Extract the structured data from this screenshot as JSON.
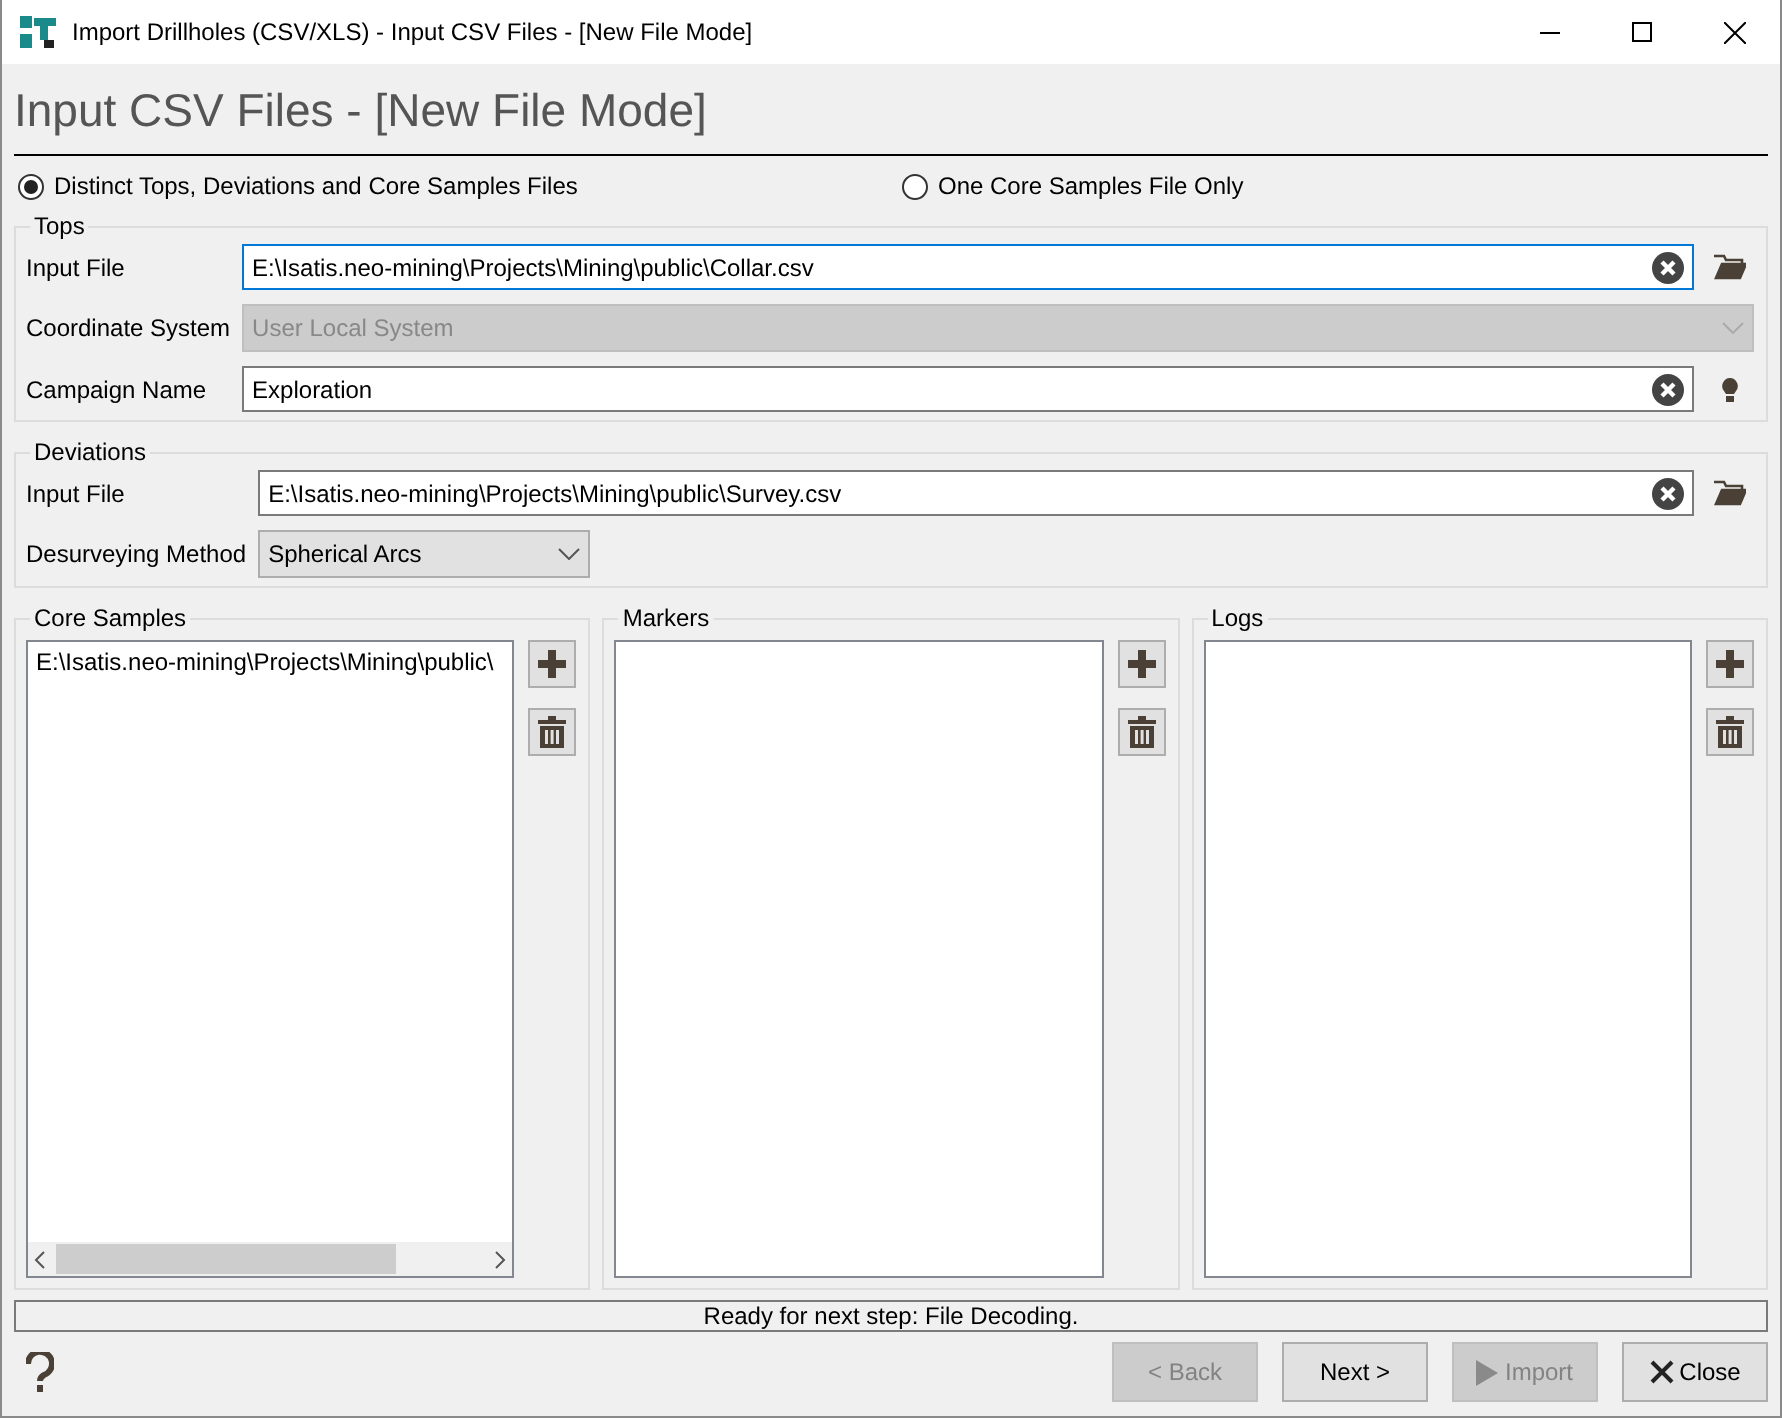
{
  "window": {
    "title": "Import Drillholes (CSV/XLS) - Input CSV Files - [New File Mode]"
  },
  "heading": "Input CSV Files - [New File Mode]",
  "mode_options": [
    {
      "label": "Distinct Tops, Deviations and Core Samples Files",
      "selected": true
    },
    {
      "label": "One Core Samples File Only",
      "selected": false
    }
  ],
  "tops": {
    "title": "Tops",
    "fields": [
      {
        "label": "Input File",
        "value": "E:\\Isatis.neo-mining\\Projects\\Mining\\public\\Collar.csv",
        "kind": "file",
        "focused": true
      },
      {
        "label": "Coordinate System",
        "value": "User Local System",
        "kind": "combo",
        "disabled": true
      },
      {
        "label": "Campaign Name",
        "value": "Exploration",
        "kind": "text",
        "focused": false
      }
    ]
  },
  "deviations": {
    "title": "Deviations",
    "fields": [
      {
        "label": "Input File",
        "value": "E:\\Isatis.neo-mining\\Projects\\Mining\\public\\Survey.csv",
        "kind": "file",
        "focused": false
      },
      {
        "label": "Desurveying Method",
        "value": "Spherical Arcs",
        "kind": "combo",
        "disabled": false
      }
    ]
  },
  "panels": [
    {
      "title": "Core Samples",
      "items": [
        "E:\\Isatis.neo-mining\\Projects\\Mining\\public\\"
      ]
    },
    {
      "title": "Markers"
    },
    {
      "title": "Logs"
    }
  ],
  "status": "Ready for next step: File Decoding.",
  "buttons": [
    {
      "label": "< Back",
      "kind": "plain",
      "disabled": true
    },
    {
      "label": "Next >",
      "kind": "plain",
      "disabled": false
    },
    {
      "label": "Import",
      "kind": "import",
      "disabled": true
    },
    {
      "label": "Close",
      "kind": "close",
      "disabled": false
    }
  ]
}
